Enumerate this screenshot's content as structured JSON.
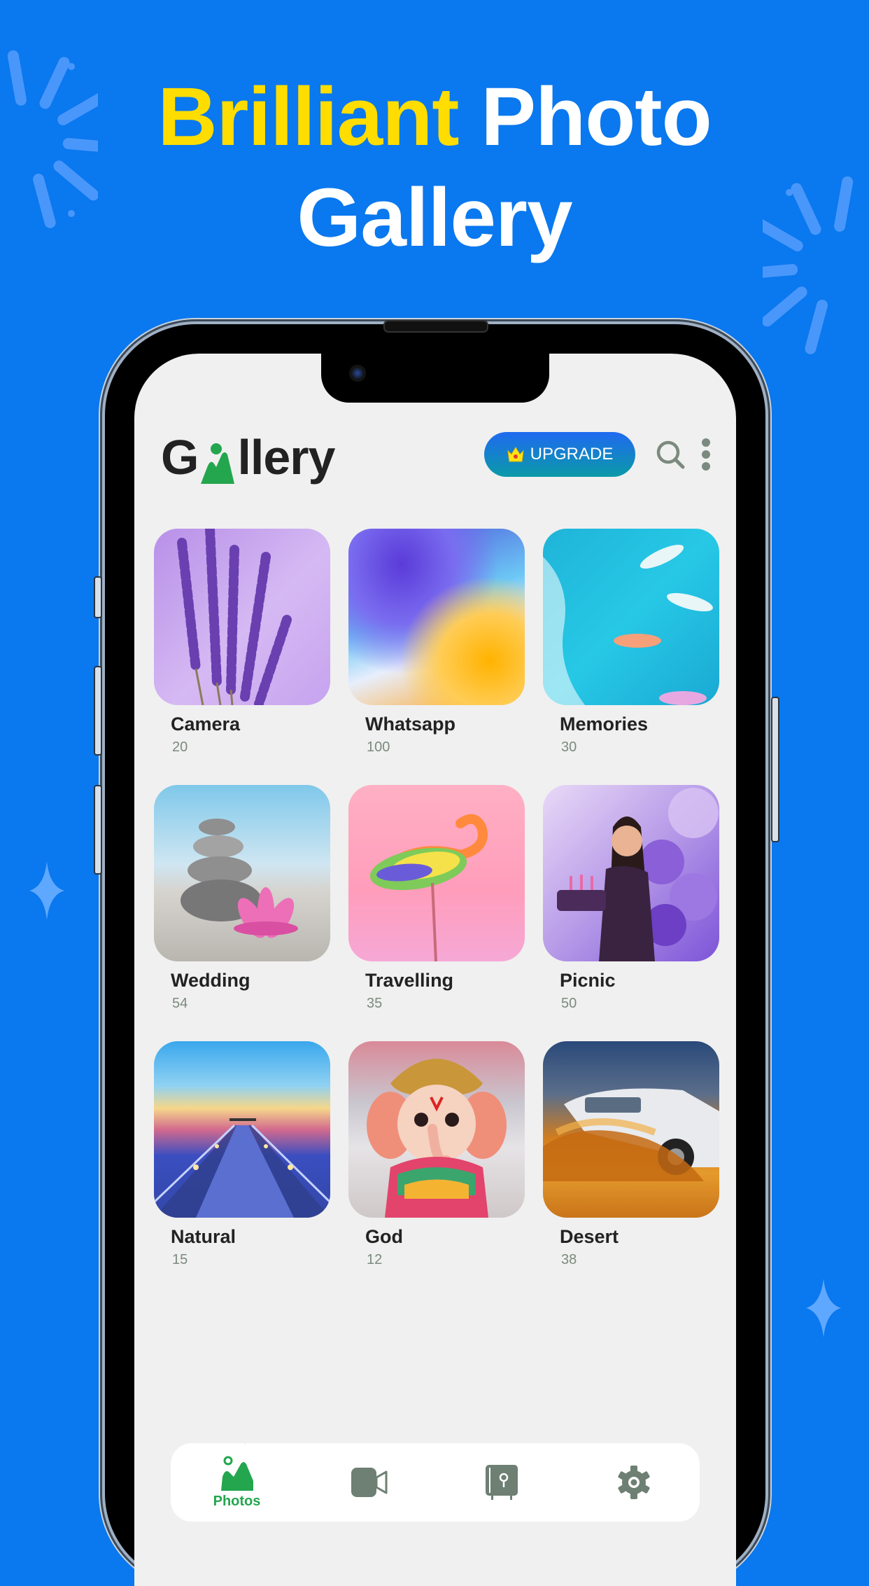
{
  "promo": {
    "headline_highlight": "Brilliant",
    "headline_rest": "Photo",
    "headline_line2": "Gallery",
    "highlight_color": "#ffdd00",
    "background_color": "#0a78ee"
  },
  "app": {
    "logo_prefix": "G",
    "logo_suffix": "llery",
    "logo_icon": "mountain-icon",
    "upgrade_label": "UPGRADE",
    "upgrade_icon": "crown-icon",
    "search_icon": "search-icon",
    "more_icon": "more-vertical-icon",
    "accent_color": "#23a64e"
  },
  "albums": [
    {
      "name": "Camera",
      "count": "20",
      "thumb": "lavender"
    },
    {
      "name": "Whatsapp",
      "count": "100",
      "thumb": "abstract-wave"
    },
    {
      "name": "Memories",
      "count": "30",
      "thumb": "boats-sea"
    },
    {
      "name": "Wedding",
      "count": "54",
      "thumb": "stones-lotus"
    },
    {
      "name": "Travelling",
      "count": "35",
      "thumb": "flamingo"
    },
    {
      "name": "Picnic",
      "count": "50",
      "thumb": "birthday-balloons"
    },
    {
      "name": "Natural",
      "count": "15",
      "thumb": "pier-sunset"
    },
    {
      "name": "God",
      "count": "12",
      "thumb": "ganesha"
    },
    {
      "name": "Desert",
      "count": "38",
      "thumb": "desert-car"
    }
  ],
  "bottom_nav": [
    {
      "label": "Photos",
      "icon": "photos-icon",
      "active": true
    },
    {
      "label": "",
      "icon": "video-icon",
      "active": false
    },
    {
      "label": "",
      "icon": "vault-icon",
      "active": false
    },
    {
      "label": "",
      "icon": "settings-icon",
      "active": false
    }
  ]
}
